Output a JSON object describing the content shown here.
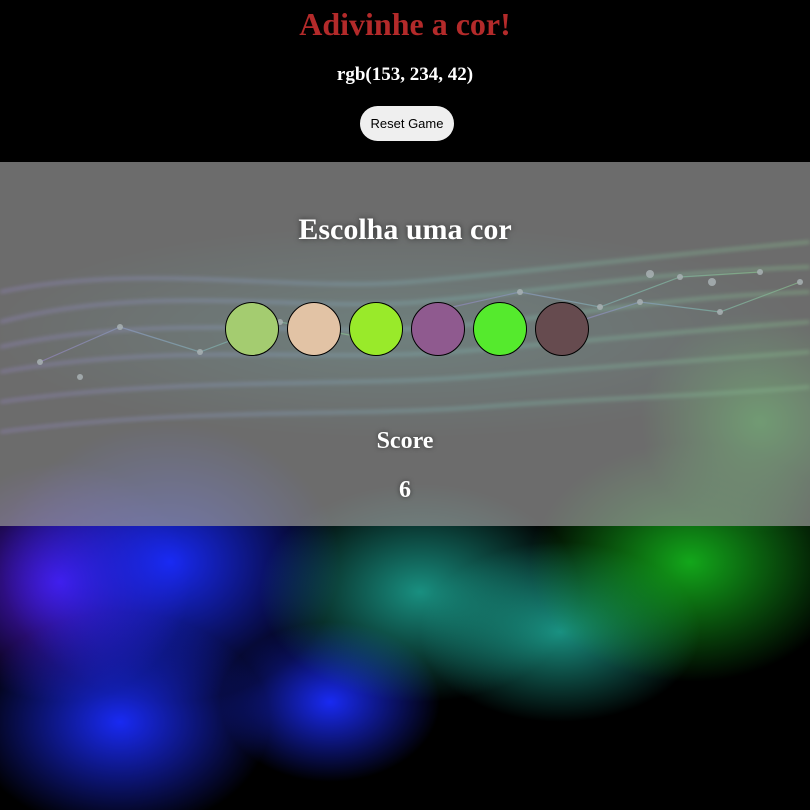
{
  "header": {
    "title": "Adivinhe a cor!",
    "rgb_target": "rgb(153, 234, 42)",
    "reset_label": "Reset Game"
  },
  "game": {
    "prompt": "Escolha uma cor",
    "swatches": [
      {
        "color": "#a4cc70"
      },
      {
        "color": "#e2c3a5"
      },
      {
        "color": "#99ea2a"
      },
      {
        "color": "#8f5a8f"
      },
      {
        "color": "#55ea2d"
      },
      {
        "color": "#664b4f"
      }
    ],
    "score_label": "Score",
    "score_value": "6"
  },
  "theme": {
    "title_color": "#b32a2a",
    "panel_color": "#969696",
    "background_image": "abstract blue-green light network"
  }
}
